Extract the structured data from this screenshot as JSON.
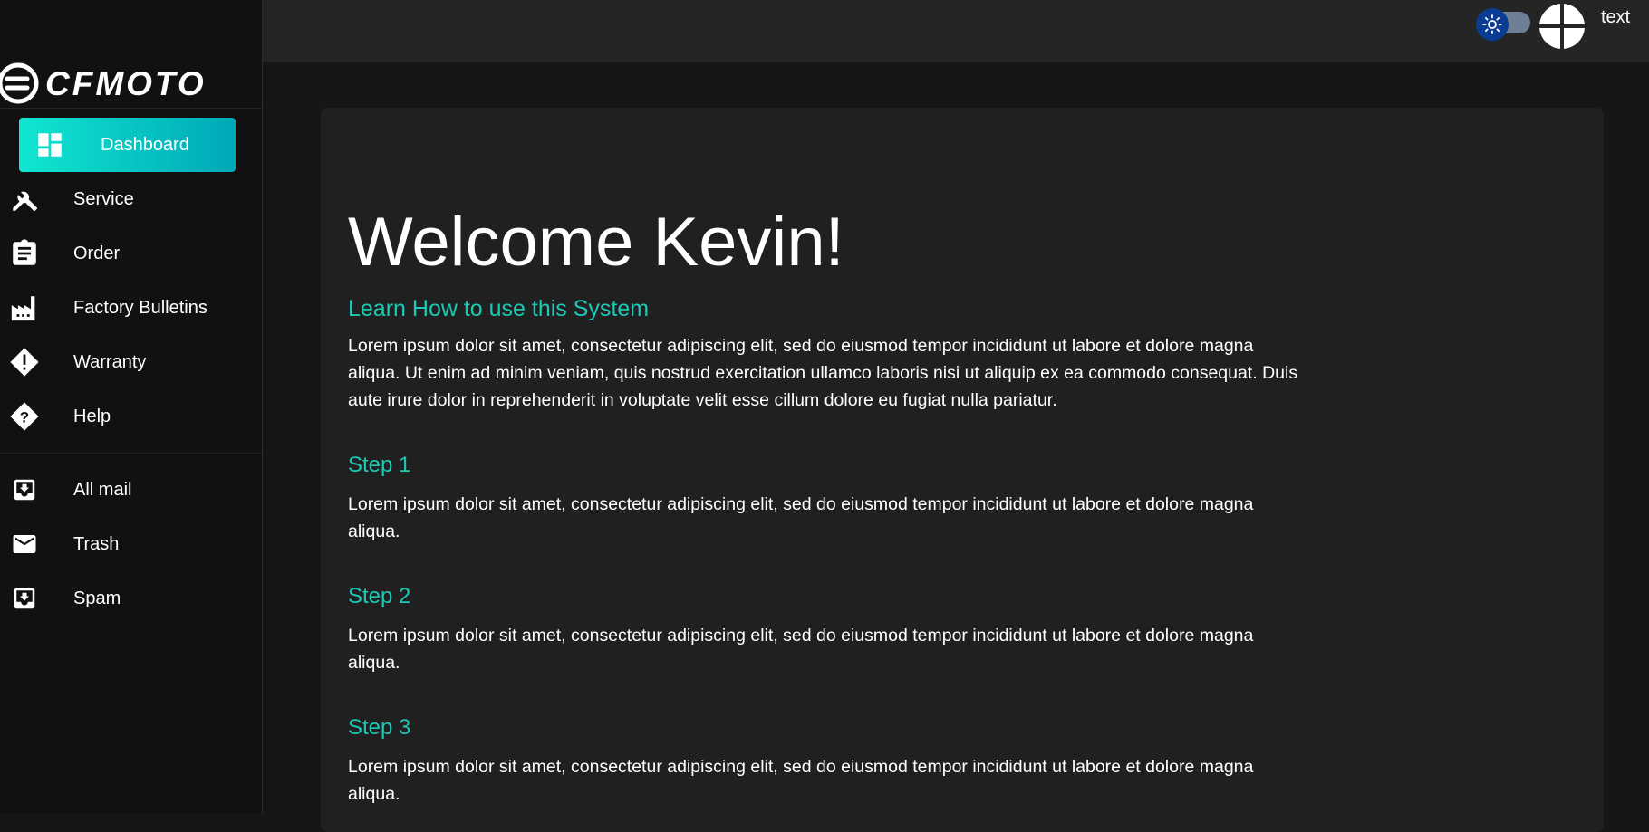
{
  "brand": {
    "name": "CFMOTO"
  },
  "sidebar": {
    "items": [
      {
        "label": "Dashboard",
        "icon": "dashboard-icon",
        "active": true
      },
      {
        "label": "Service",
        "icon": "tools-icon"
      },
      {
        "label": "Order",
        "icon": "clipboard-icon"
      },
      {
        "label": "Factory Bulletins",
        "icon": "factory-icon"
      },
      {
        "label": "Warranty",
        "icon": "warning-diamond-icon"
      },
      {
        "label": "Help",
        "icon": "help-diamond-icon"
      }
    ],
    "mail_items": [
      {
        "label": "All mail",
        "icon": "inbox-icon"
      },
      {
        "label": "Trash",
        "icon": "mail-icon"
      },
      {
        "label": "Spam",
        "icon": "inbox-icon"
      }
    ]
  },
  "header": {
    "user_name": "text",
    "theme_toggle_icon": "sun-icon",
    "avatar_icon": "avatar-icon"
  },
  "colors": {
    "accent": "#1cc9b5",
    "active_gradient_start": "#10e6d0",
    "active_gradient_end": "#00a8b8",
    "toggle_knob": "#0a3d91",
    "toggle_track": "#6f7f95"
  },
  "main": {
    "title": "Welcome Kevin!",
    "subtitle": "Learn How to use this System",
    "intro": "Lorem ipsum dolor sit amet, consectetur adipiscing elit, sed do eiusmod tempor incididunt ut labore et dolore magna aliqua. Ut enim ad minim veniam, quis nostrud exercitation ullamco laboris nisi ut aliquip ex ea commodo consequat. Duis aute irure dolor in reprehenderit in voluptate velit esse cillum dolore eu fugiat nulla pariatur.",
    "steps": [
      {
        "title": "Step 1",
        "text": "Lorem ipsum dolor sit amet, consectetur adipiscing elit, sed do eiusmod tempor incididunt ut labore et dolore magna aliqua."
      },
      {
        "title": "Step 2",
        "text": "Lorem ipsum dolor sit amet, consectetur adipiscing elit, sed do eiusmod tempor incididunt ut labore et dolore magna aliqua."
      },
      {
        "title": "Step 3",
        "text": "Lorem ipsum dolor sit amet, consectetur adipiscing elit, sed do eiusmod tempor incididunt ut labore et dolore magna aliqua."
      }
    ]
  }
}
